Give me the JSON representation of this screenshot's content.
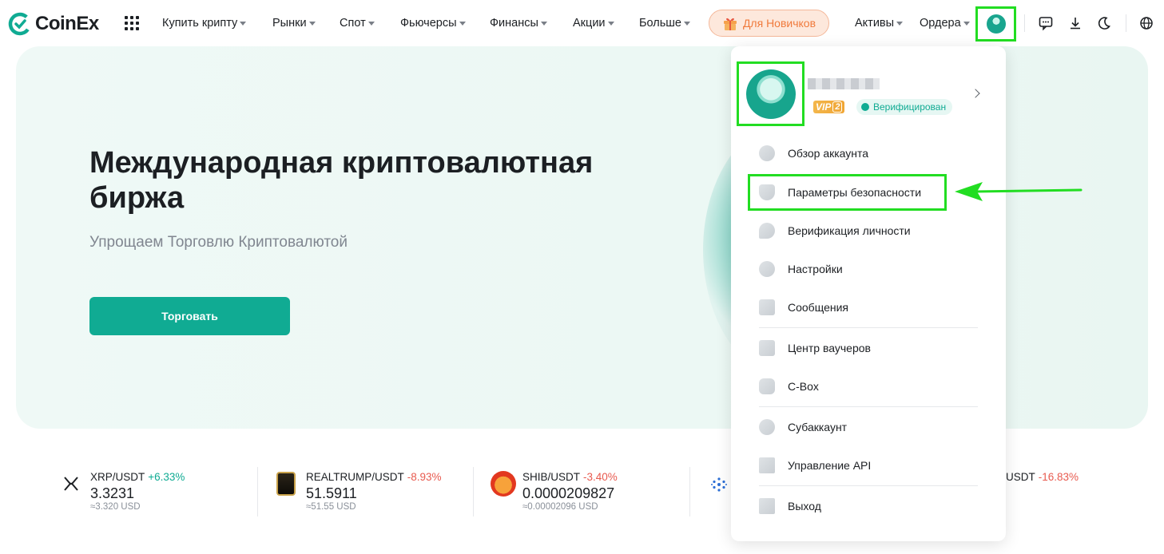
{
  "header": {
    "logo_text": "CoinEx",
    "nav": [
      {
        "label": "Купить крипту",
        "left": 0
      },
      {
        "label": "Рынки"
      },
      {
        "label": "Спот"
      },
      {
        "label": "Фьючерсы"
      },
      {
        "label": "Финансы"
      },
      {
        "label": "Акции"
      },
      {
        "label": "Больше"
      }
    ],
    "promo_label": "Для Новичков",
    "assets_label": "Активы",
    "orders_label": "Ордера"
  },
  "hero": {
    "title": "Международная криптовалютная биржа",
    "subtitle": "Упрощаем Торговлю Криптовалютой",
    "trade_button": "Торговать"
  },
  "ticker": [
    {
      "pair": "XRP/USDT",
      "change": "+6.33%",
      "direction": "up",
      "price": "3.3231",
      "approx": "≈3.320 USD"
    },
    {
      "pair": "REALTRUMP/USDT",
      "change": "-8.93%",
      "direction": "down",
      "price": "51.5911",
      "approx": "≈51.55 USD"
    },
    {
      "pair": "SHIB/USDT",
      "change": "-3.40%",
      "direction": "down",
      "price": "0.0000209827",
      "approx": "≈0.00002096 USD"
    },
    {
      "pair": "USDT",
      "change": "-16.83%",
      "direction": "down"
    }
  ],
  "account_menu": {
    "vip_label": "VIP",
    "vip_level": "2",
    "verified_label": "Верифицирован",
    "items": [
      {
        "label": "Обзор аккаунта"
      },
      {
        "label": "Параметры безопасности"
      },
      {
        "label": "Верификация личности"
      },
      {
        "label": "Настройки"
      },
      {
        "label": "Сообщения"
      },
      {
        "label": "Центр ваучеров"
      },
      {
        "label": "C-Box"
      },
      {
        "label": "Субаккаунт"
      },
      {
        "label": "Управление API"
      },
      {
        "label": "Выход"
      }
    ]
  },
  "colors": {
    "brand": "#10ab93",
    "up": "#10ab93",
    "down": "#e85a4f",
    "highlight": "#22dd22",
    "promo": "#f07a3c"
  }
}
